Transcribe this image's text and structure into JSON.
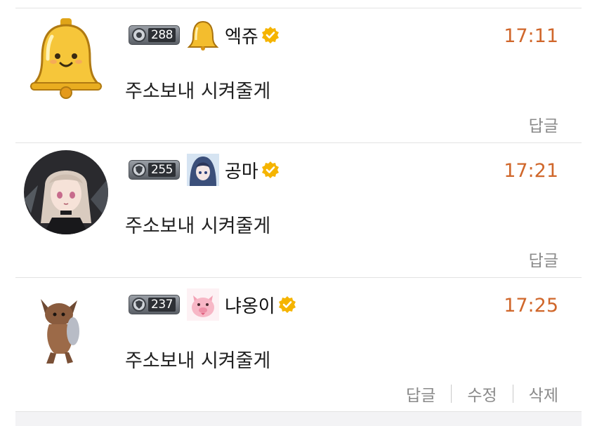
{
  "comments": [
    {
      "avatar": "bell-character",
      "level": "288",
      "emblem": "gold-bell-emblem",
      "nickname": "엑쥬",
      "verified": true,
      "time": "17:11",
      "text": "주소보내 시켜줄게",
      "actions": [
        "답글"
      ]
    },
    {
      "avatar": "anime-girl-portrait",
      "level": "255",
      "emblem": "hooded-character-emblem",
      "nickname": "공마",
      "verified": true,
      "time": "17:21",
      "text": "주소보내 시켜줄게",
      "actions": [
        "답글"
      ]
    },
    {
      "avatar": "dancing-cat",
      "level": "237",
      "emblem": "pink-pig-emblem",
      "nickname": "냐옹이",
      "verified": true,
      "time": "17:25",
      "text": "주소보내 시켜줄게",
      "actions": [
        "답글",
        "수정",
        "삭제"
      ]
    }
  ],
  "colors": {
    "time": "#d0672b",
    "verified": "#f5b400",
    "divider": "#e2e2e2",
    "action_text": "#8a8a8a"
  }
}
